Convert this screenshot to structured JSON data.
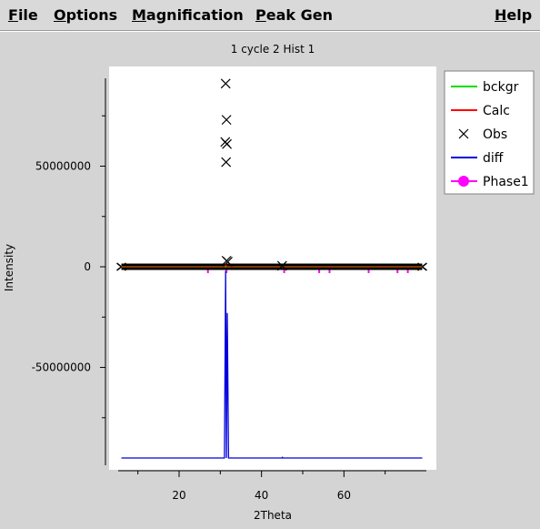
{
  "menubar": {
    "items": [
      {
        "key": "file",
        "mnemonic": "F",
        "rest": "ile"
      },
      {
        "key": "options",
        "mnemonic": "O",
        "rest": "ptions"
      },
      {
        "key": "magnification",
        "mnemonic": "M",
        "rest": "agnification"
      },
      {
        "key": "peak_gen",
        "mnemonic": "P",
        "rest": "eak Gen"
      },
      {
        "key": "help",
        "mnemonic": "H",
        "rest": "elp"
      }
    ]
  },
  "chart_data": {
    "type": "line",
    "title": "1 cycle 2 Hist 1",
    "xlabel": "2Theta",
    "ylabel": "Intensity",
    "xlim": [
      5,
      80
    ],
    "ylim": [
      -95000000,
      95000000
    ],
    "x_ticks": [
      20,
      40,
      60
    ],
    "y_ticks": [
      50000000,
      0,
      -50000000
    ],
    "x_tick_labels": [
      "20",
      "40",
      "60"
    ],
    "y_tick_labels": [
      "50000000",
      "0",
      "-50000000"
    ],
    "grid": false,
    "legend_position": "right",
    "legend": [
      {
        "label": "bckgr",
        "color": "#00dd00",
        "marker": "line"
      },
      {
        "label": "Calc",
        "color": "#ff0000",
        "marker": "line"
      },
      {
        "label": "Obs",
        "color": "#000000",
        "marker": "x"
      },
      {
        "label": "diff",
        "color": "#0000dd",
        "marker": "line"
      },
      {
        "label": "Phase1",
        "color": "#ff00ff",
        "marker": "circle"
      }
    ],
    "series": [
      {
        "name": "bckgr",
        "x": [
          6,
          79
        ],
        "y": [
          0,
          0
        ]
      },
      {
        "name": "Calc",
        "x": [
          6,
          31,
          31.3,
          31.6,
          32,
          79
        ],
        "y": [
          0,
          0,
          1500000,
          0,
          0,
          0
        ]
      },
      {
        "name": "Obs",
        "x": [
          31.3,
          31.5,
          31.2,
          31.6,
          31.4,
          31.5,
          31.8,
          45
        ],
        "y": [
          91000000,
          73000000,
          62000000,
          61000000,
          52000000,
          3000000,
          2500000,
          500000
        ]
      },
      {
        "name": "diff",
        "x": [
          6,
          31,
          31.3,
          31.5,
          31.7,
          32,
          45,
          45.1,
          45.2,
          79
        ],
        "y": [
          -95000000,
          -95000000,
          -2000000,
          -95000000,
          -23000000,
          -95000000,
          -95000000,
          -94700000,
          -95000000,
          -95000000
        ]
      },
      {
        "name": "Phase1",
        "reflections": [
          27,
          31.5,
          45.5,
          54,
          56.5,
          66,
          73,
          75.5
        ]
      }
    ]
  }
}
